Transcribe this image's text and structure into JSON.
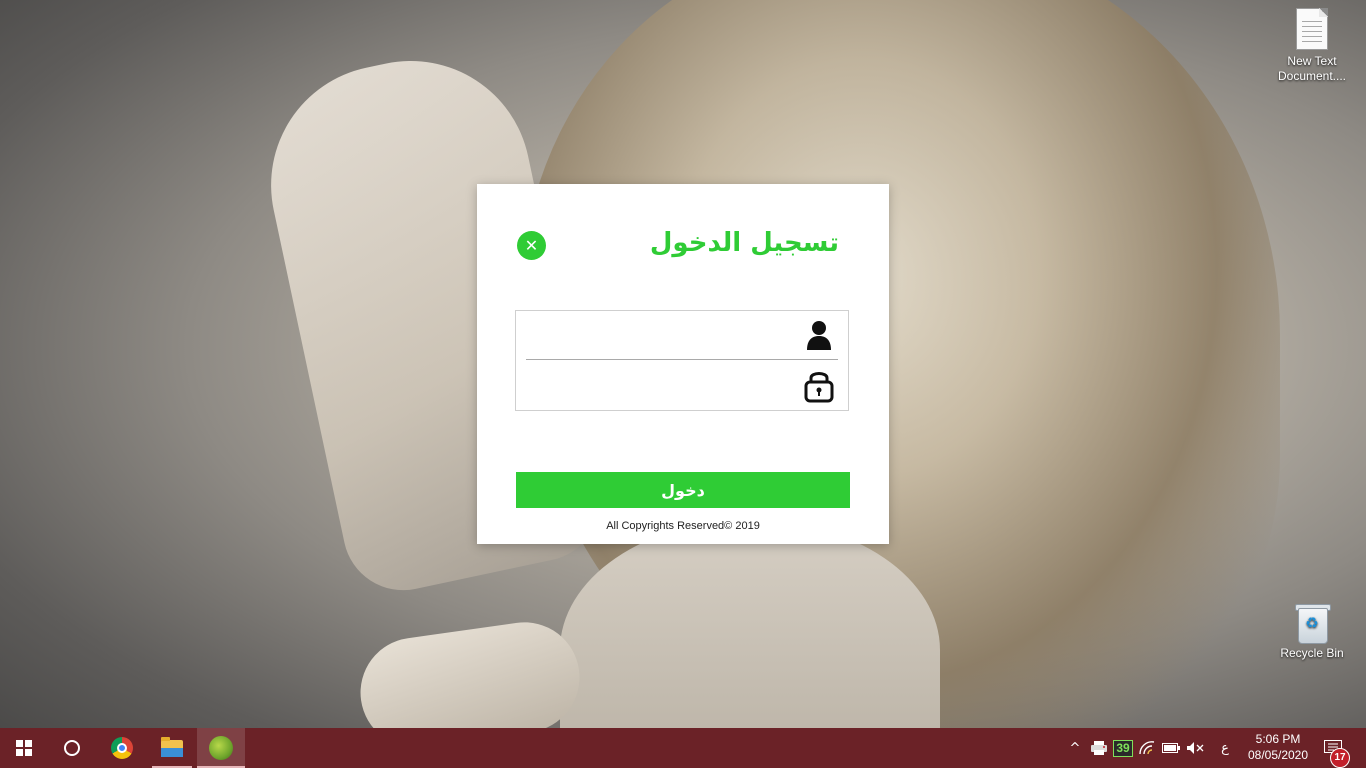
{
  "desktop": {
    "icons": [
      {
        "label": "New Text Document....",
        "icon": "text-document-icon"
      },
      {
        "label": "Recycle Bin",
        "icon": "recycle-bin-icon"
      }
    ]
  },
  "login": {
    "title": "تسجيل الدخول",
    "close_symbol": "✕",
    "username_value": "",
    "password_value": "",
    "submit_label": "دخول",
    "copyright": "All Copyrights Reserved© 2019",
    "accent_color": "#2fcc35"
  },
  "taskbar": {
    "background_color": "#6b2227",
    "apps": [
      {
        "name": "start",
        "icon": "windows-logo-icon"
      },
      {
        "name": "cortana",
        "icon": "cortana-circle-icon"
      },
      {
        "name": "chrome",
        "icon": "chrome-icon"
      },
      {
        "name": "file-explorer",
        "icon": "folder-icon"
      },
      {
        "name": "login-app",
        "icon": "app-icon"
      }
    ],
    "tray": {
      "chevron": "^",
      "badge_value": "39",
      "mute_symbol": "🔇",
      "ime_indicator": "ع",
      "time": "5:06 PM",
      "date": "08/05/2020",
      "notifications_count": "17"
    }
  }
}
